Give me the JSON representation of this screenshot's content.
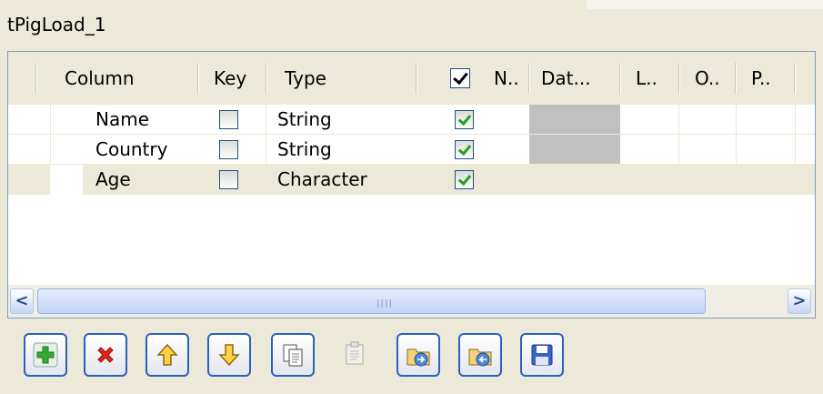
{
  "title": "tPigLoad_1",
  "columns": {
    "column": "Column",
    "key": "Key",
    "type": "Type",
    "nullable": "N..",
    "date_pattern": "Dat...",
    "length": "L..",
    "other": "O..",
    "precision": "P.."
  },
  "rows": [
    {
      "name": "Name",
      "type": "String",
      "key": false,
      "nullable": true
    },
    {
      "name": "Country",
      "type": "String",
      "key": false,
      "nullable": true
    },
    {
      "name": "Age",
      "type": "Character",
      "key": false,
      "nullable": true
    }
  ],
  "scrollbar": {
    "left_arrow": "<",
    "right_arrow": ">",
    "grip": "IIII"
  },
  "toolbar": [
    {
      "icon": "add-icon",
      "enabled": true
    },
    {
      "icon": "remove-icon",
      "enabled": true
    },
    {
      "icon": "move-up-icon",
      "enabled": true
    },
    {
      "icon": "move-down-icon",
      "enabled": true
    },
    {
      "icon": "copy-icon",
      "enabled": true
    },
    {
      "icon": "paste-icon",
      "enabled": false
    },
    {
      "icon": "import-icon",
      "enabled": true
    },
    {
      "icon": "export-icon",
      "enabled": true
    },
    {
      "icon": "save-icon",
      "enabled": true
    }
  ],
  "colors": {
    "accent": "#2d5fbf",
    "check": "#21a121",
    "selected_row": "#ece9d8"
  }
}
